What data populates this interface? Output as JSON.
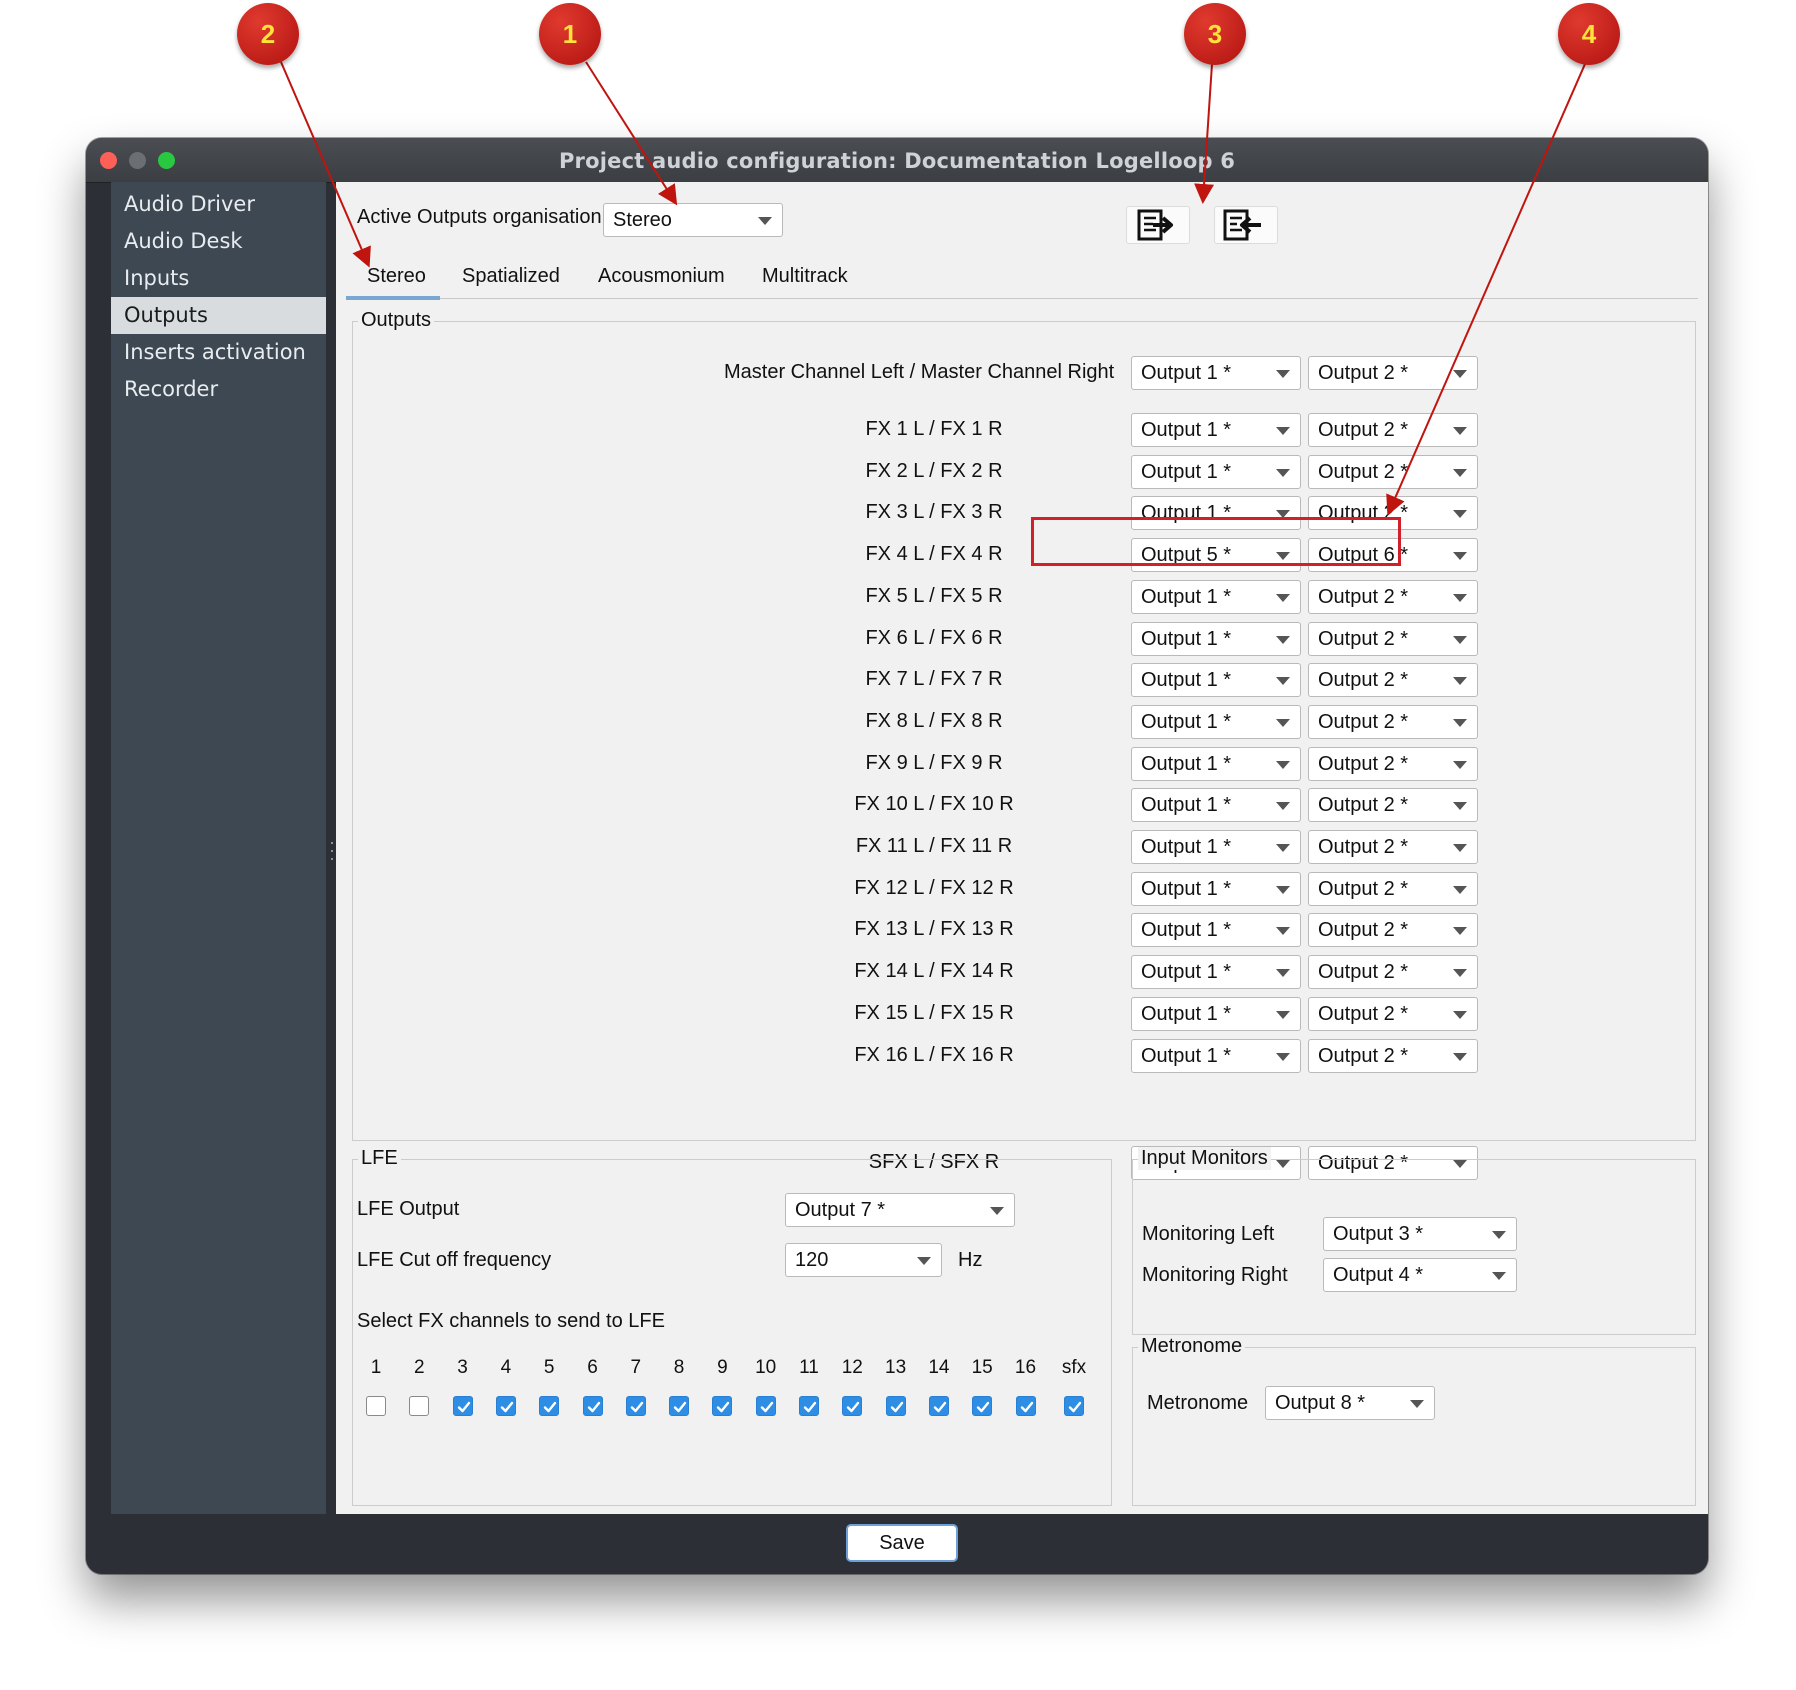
{
  "window": {
    "title": "Project audio configuration: Documentation Logelloop 6"
  },
  "sidebar": {
    "items": [
      {
        "label": "Audio Driver"
      },
      {
        "label": "Audio Desk"
      },
      {
        "label": "Inputs"
      },
      {
        "label": "Outputs",
        "active": true
      },
      {
        "label": "Inserts activation"
      },
      {
        "label": "Recorder"
      }
    ]
  },
  "header": {
    "org_label": "Active Outputs organisation",
    "org_value": "Stereo",
    "export_icon": "export-icon",
    "import_icon": "import-icon"
  },
  "tabs": [
    {
      "label": "Stereo",
      "active": true
    },
    {
      "label": "Spatialized"
    },
    {
      "label": "Acousmonium"
    },
    {
      "label": "Multitrack"
    }
  ],
  "outputs": {
    "title": "Outputs",
    "rows": [
      {
        "label": "Master Channel Left / Master Channel Right",
        "left": "Output 1 *",
        "right": "Output 2 *"
      },
      {
        "label": "FX 1 L / FX 1 R",
        "left": "Output 1 *",
        "right": "Output 2 *"
      },
      {
        "label": "FX 2 L / FX 2 R",
        "left": "Output 1 *",
        "right": "Output 2 *"
      },
      {
        "label": "FX 3 L / FX 3 R",
        "left": "Output 1 *",
        "right": "Output 2 *"
      },
      {
        "label": "FX 4 L / FX 4 R",
        "left": "Output 5 *",
        "right": "Output 6 *"
      },
      {
        "label": "FX 5 L / FX 5 R",
        "left": "Output 1 *",
        "right": "Output 2 *"
      },
      {
        "label": "FX 6 L / FX 6 R",
        "left": "Output 1 *",
        "right": "Output 2 *"
      },
      {
        "label": "FX 7 L / FX 7 R",
        "left": "Output 1 *",
        "right": "Output 2 *"
      },
      {
        "label": "FX 8 L / FX 8 R",
        "left": "Output 1 *",
        "right": "Output 2 *"
      },
      {
        "label": "FX 9 L / FX 9 R",
        "left": "Output 1 *",
        "right": "Output 2 *"
      },
      {
        "label": "FX 10 L / FX 10 R",
        "left": "Output 1 *",
        "right": "Output 2 *"
      },
      {
        "label": "FX 11 L / FX 11 R",
        "left": "Output 1 *",
        "right": "Output 2 *"
      },
      {
        "label": "FX 12 L / FX 12 R",
        "left": "Output 1 *",
        "right": "Output 2 *"
      },
      {
        "label": "FX 13 L / FX 13 R",
        "left": "Output 1 *",
        "right": "Output 2 *"
      },
      {
        "label": "FX 14 L / FX 14 R",
        "left": "Output 1 *",
        "right": "Output 2 *"
      },
      {
        "label": "FX 15 L / FX 15 R",
        "left": "Output 1 *",
        "right": "Output 2 *"
      },
      {
        "label": "FX 16 L / FX 16 R",
        "left": "Output 1 *",
        "right": "Output 2 *"
      },
      {
        "label": "SFX L / SFX R",
        "left": "Output 1 *",
        "right": "Output 2 *"
      }
    ]
  },
  "lfe": {
    "title": "LFE",
    "output_label": "LFE Output",
    "output_value": "Output 7 *",
    "cutoff_label": "LFE Cut off frequency",
    "cutoff_value": "120",
    "cutoff_unit": "Hz",
    "select_label": "Select FX channels to send to LFE",
    "channels": [
      {
        "label": "1",
        "checked": false
      },
      {
        "label": "2",
        "checked": false
      },
      {
        "label": "3",
        "checked": true
      },
      {
        "label": "4",
        "checked": true
      },
      {
        "label": "5",
        "checked": true
      },
      {
        "label": "6",
        "checked": true
      },
      {
        "label": "7",
        "checked": true
      },
      {
        "label": "8",
        "checked": true
      },
      {
        "label": "9",
        "checked": true
      },
      {
        "label": "10",
        "checked": true
      },
      {
        "label": "11",
        "checked": true
      },
      {
        "label": "12",
        "checked": true
      },
      {
        "label": "13",
        "checked": true
      },
      {
        "label": "14",
        "checked": true
      },
      {
        "label": "15",
        "checked": true
      },
      {
        "label": "16",
        "checked": true
      },
      {
        "label": "sfx",
        "checked": true
      }
    ]
  },
  "monitors": {
    "title": "Input Monitors",
    "left_label": "Monitoring Left",
    "left_value": "Output 3 *",
    "right_label": "Monitoring Right",
    "right_value": "Output 4 *"
  },
  "metronome": {
    "title": "Metronome",
    "label": "Metronome",
    "value": "Output 8 *"
  },
  "footer": {
    "save_label": "Save"
  },
  "annotations": [
    {
      "number": "1"
    },
    {
      "number": "2"
    },
    {
      "number": "3"
    },
    {
      "number": "4"
    }
  ],
  "colors": {
    "annotation": "#c0140f",
    "annotation_text": "#ffe23a",
    "highlight": "#d2202b",
    "checkbox": "#2e8ee6"
  }
}
